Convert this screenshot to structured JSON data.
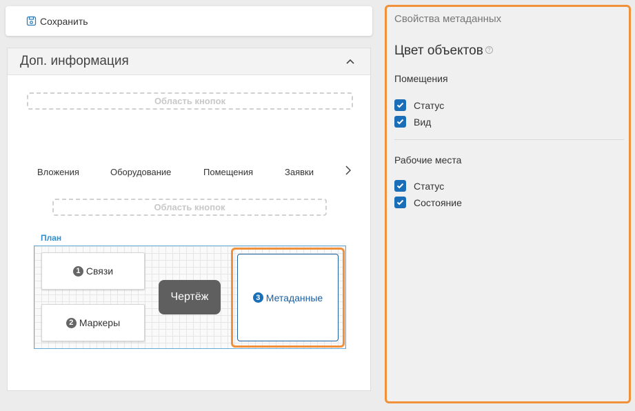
{
  "toolbar": {
    "save_label": "Сохранить"
  },
  "info_panel": {
    "title": "Доп. информация",
    "button_area_top": "Область кнопок",
    "button_area_bottom": "Область кнопок",
    "tabs": [
      {
        "label": "Вложения"
      },
      {
        "label": "Оборудование"
      },
      {
        "label": "Помещения"
      },
      {
        "label": "Заявки"
      }
    ],
    "plan": {
      "label": "План",
      "cards": [
        {
          "number": "1",
          "label": "Связи"
        },
        {
          "number": "2",
          "label": "Маркеры"
        },
        {
          "number": "3",
          "label": "Метаданные"
        }
      ],
      "drawing_label": "Чертёж"
    }
  },
  "properties": {
    "title": "Свойства метаданных",
    "color_title": "Цвет объектов",
    "help_icon": "?",
    "groups": [
      {
        "label": "Помещения",
        "items": [
          {
            "label": "Статус",
            "checked": true
          },
          {
            "label": "Вид",
            "checked": true
          }
        ]
      },
      {
        "label": "Рабочие места",
        "items": [
          {
            "label": "Статус",
            "checked": true
          },
          {
            "label": "Состояние",
            "checked": true
          }
        ]
      }
    ]
  },
  "colors": {
    "accent_orange": "#f0913a",
    "checkbox_blue": "#1a6eb7",
    "plan_blue": "#2c8fd1"
  },
  "icons": {
    "save": "save-icon",
    "collapse": "chevron-up-icon",
    "next": "chevron-right-icon",
    "help": "help-icon",
    "check": "check-icon"
  }
}
